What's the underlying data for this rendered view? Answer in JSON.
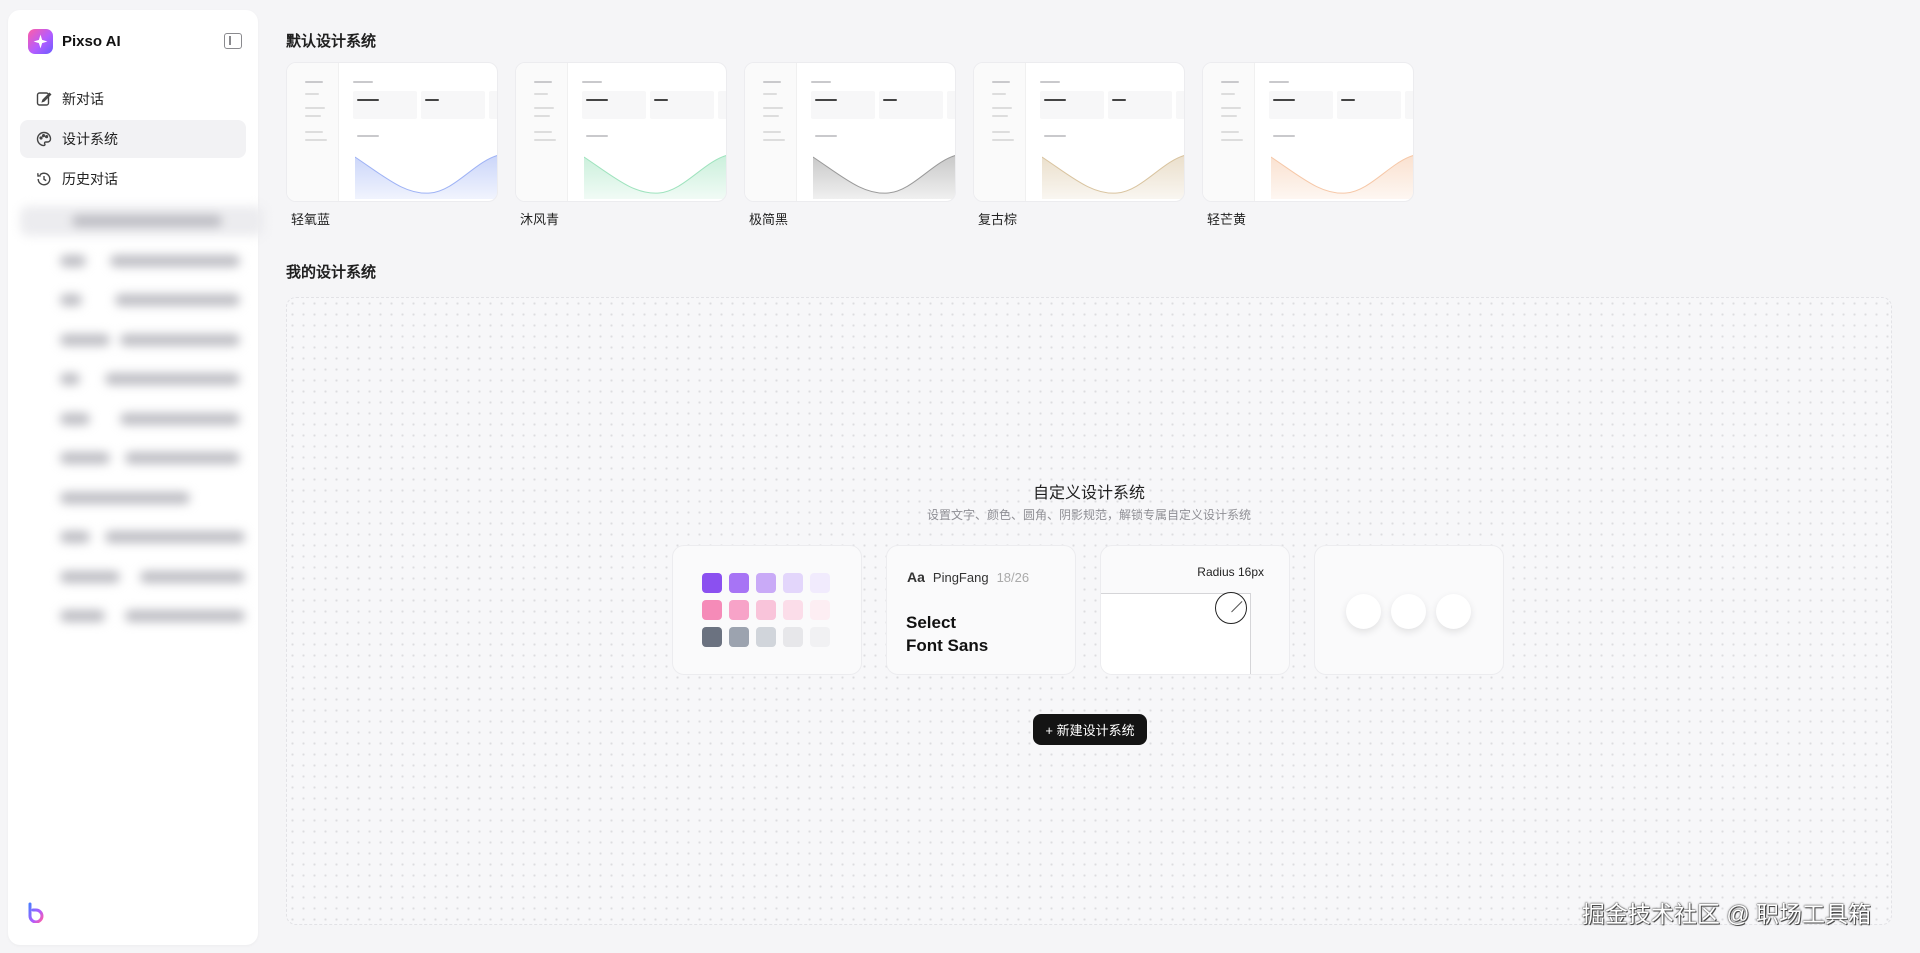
{
  "app": {
    "name": "Pixso AI"
  },
  "sidebar": {
    "items": [
      {
        "label": "新对话",
        "icon": "edit-icon",
        "active": false
      },
      {
        "label": "设计系统",
        "icon": "palette-icon",
        "active": true
      },
      {
        "label": "历史对话",
        "icon": "history-icon",
        "active": false
      }
    ]
  },
  "defaults": {
    "title": "默认设计系统",
    "items": [
      {
        "label": "轻氧蓝",
        "accent": "#9fb3f5"
      },
      {
        "label": "沐风青",
        "accent": "#9fe3be"
      },
      {
        "label": "极简黑",
        "accent": "#9a9a9a"
      },
      {
        "label": "复古棕",
        "accent": "#d9c4a0"
      },
      {
        "label": "轻芒黄",
        "accent": "#f6c8a8"
      }
    ]
  },
  "mine": {
    "title": "我的设计系统",
    "custom_title": "自定义设计系统",
    "custom_sub": "设置文字、颜色、圆角、阴影规范，解锁专属自定义设计系统",
    "font_card": {
      "aa": "Aa",
      "font": "PingFang",
      "size": "18/26",
      "demo_line1": "Select",
      "demo_line2": "Font Sans"
    },
    "radius_card": {
      "label": "Radius 16px"
    },
    "swatch_colors": [
      "#8b50f0",
      "#a774f5",
      "#c9aaf7",
      "#e3d6fb",
      "#f1ebfd",
      "#f58bb8",
      "#f7a3c8",
      "#f9c4da",
      "#fbdde9",
      "#fdeef3",
      "#6b7280",
      "#9ca3af",
      "#d1d5db",
      "#e7e7ea",
      "#f1f1f3"
    ],
    "new_button": "+ 新建设计系统"
  },
  "watermark": "掘金技术社区 @ 职场工具箱"
}
